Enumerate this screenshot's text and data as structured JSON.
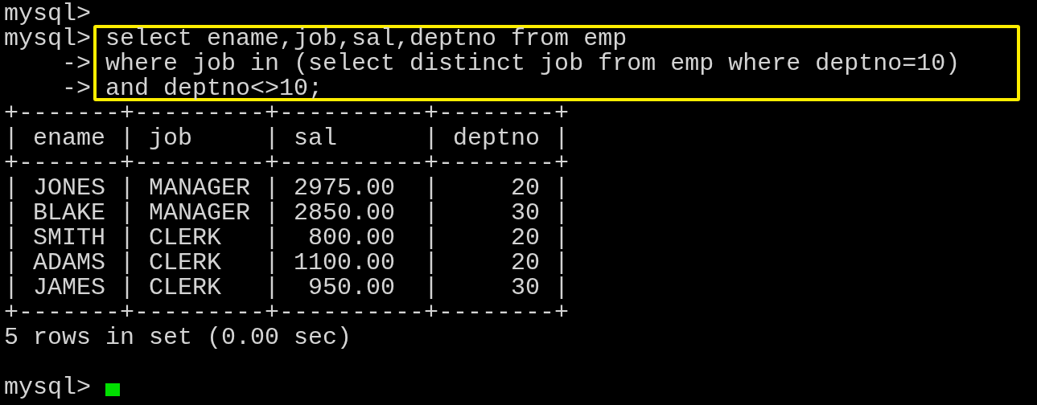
{
  "lines": [
    {
      "kind": "prompt",
      "prompt": "mysql>"
    },
    {
      "kind": "block",
      "highlighted": true,
      "lines": [
        {
          "prompt": "mysql>",
          "text": "select ename,job,sal,deptno from emp"
        },
        {
          "prompt": "    ->",
          "text": "where job in (select distinct job from emp where deptno=10)"
        },
        {
          "prompt": "    ->",
          "text": "and deptno<>10;"
        }
      ]
    },
    {
      "kind": "border",
      "text": "+-------+---------+----------+--------+"
    },
    {
      "kind": "row",
      "text": "| ename | job     | sal      | deptno |"
    },
    {
      "kind": "border",
      "text": "+-------+---------+----------+--------+"
    },
    {
      "kind": "row",
      "text": "| JONES | MANAGER | 2975.00  |     20 |"
    },
    {
      "kind": "row",
      "text": "| BLAKE | MANAGER | 2850.00  |     30 |"
    },
    {
      "kind": "row",
      "text": "| SMITH | CLERK   |  800.00  |     20 |"
    },
    {
      "kind": "row",
      "text": "| ADAMS | CLERK   | 1100.00  |     20 |"
    },
    {
      "kind": "row",
      "text": "| JAMES | CLERK   |  950.00  |     30 |"
    },
    {
      "kind": "border",
      "text": "+-------+---------+----------+--------+"
    },
    {
      "kind": "output",
      "text": "5 rows in set (0.00 sec)"
    },
    {
      "kind": "blank"
    },
    {
      "kind": "cursor",
      "prompt": "mysql>"
    }
  ]
}
